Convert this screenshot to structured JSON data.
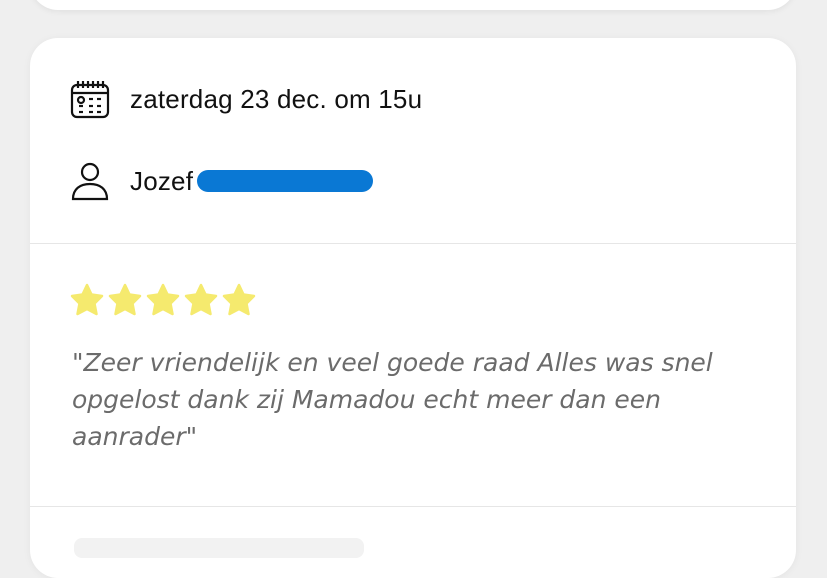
{
  "booking": {
    "date_text": "zaterdag 23 dec. om 15u",
    "customer_name": "Jozef"
  },
  "review": {
    "rating": 5,
    "max_rating": 5,
    "text": "\"Zeer vriendelijk en veel goede raad Alles was snel opgelost dank zij Mamadou echt meer dan een aanrader\""
  },
  "icons": {
    "date": "calendar-icon",
    "person": "user-icon",
    "star": "star-icon"
  },
  "colors": {
    "star": "#f5ea6e",
    "redaction": "#0a78d4",
    "review_text": "#6b6b6b"
  }
}
